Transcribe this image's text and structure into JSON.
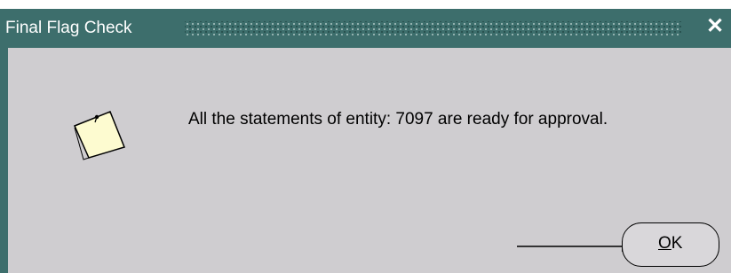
{
  "window": {
    "title": "Final Flag Check",
    "close_glyph": "✕"
  },
  "message": {
    "text": "All the statements of entity: 7097 are ready for approval."
  },
  "buttons": {
    "ok_mnemonic": "O",
    "ok_rest": "K"
  },
  "icons": {
    "note": "note-icon",
    "close": "close-icon",
    "annotation_arrow": "arrow-icon"
  },
  "colors": {
    "titlebar": "#3d6e6c",
    "dialog_bg": "#cfcdd0",
    "note_fill": "#fdfbd0"
  }
}
